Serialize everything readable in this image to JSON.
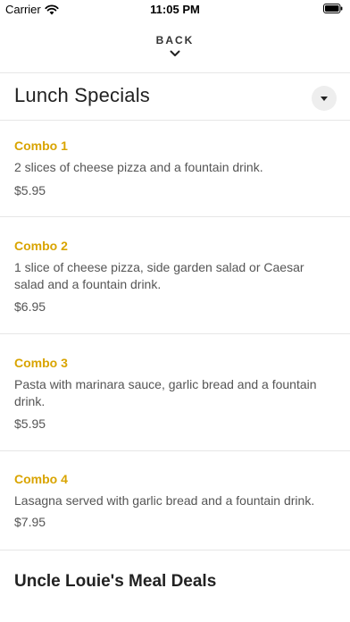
{
  "status_bar": {
    "carrier": "Carrier",
    "time": "11:05 PM"
  },
  "nav": {
    "back_label": "BACK"
  },
  "section": {
    "title": "Lunch Specials"
  },
  "items": [
    {
      "name": "Combo 1",
      "description": "2 slices of cheese pizza and a fountain drink.",
      "price": "$5.95"
    },
    {
      "name": "Combo 2",
      "description": "1 slice of cheese pizza, side garden salad or Caesar salad and a fountain drink.",
      "price": "$6.95"
    },
    {
      "name": "Combo 3",
      "description": "Pasta with marinara sauce, garlic bread and a fountain drink.",
      "price": "$5.95"
    },
    {
      "name": "Combo 4",
      "description": "Lasagna served with garlic bread and a fountain drink.",
      "price": "$7.95"
    }
  ],
  "next_section": {
    "title": "Uncle Louie's Meal Deals"
  },
  "colors": {
    "accent": "#d9a400",
    "divider": "#e6e6e6",
    "text": "#555555"
  }
}
